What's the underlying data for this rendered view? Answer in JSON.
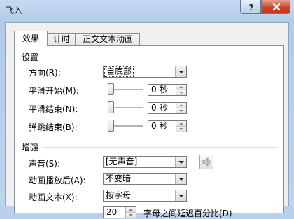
{
  "window": {
    "title": "飞入",
    "help_icon": "question-icon",
    "close_icon": "close-icon"
  },
  "tabs": [
    {
      "label": "效果",
      "active": true
    },
    {
      "label": "计时",
      "active": false
    },
    {
      "label": "正文文本动画",
      "active": false
    }
  ],
  "settings": {
    "group_label": "设置",
    "direction": {
      "label": "方向(R):",
      "value": "自底部"
    },
    "smooth_start": {
      "label": "平滑开始(M):",
      "value": "0",
      "unit": "秒"
    },
    "smooth_end": {
      "label": "平滑结束(N):",
      "value": "0",
      "unit": "秒"
    },
    "bounce_end": {
      "label": "弹跳结束(B):",
      "value": "0",
      "unit": "秒"
    }
  },
  "enhancements": {
    "group_label": "增强",
    "sound": {
      "label": "声音(S):",
      "value": "[无声音]",
      "button_icon": "speaker-icon"
    },
    "after_animation": {
      "label": "动画播放后(A):",
      "value": "不变暗"
    },
    "animate_text": {
      "label": "动画文本(X):",
      "value": "按字母"
    },
    "delay": {
      "value": "20",
      "label": "字母之间延迟百分比(D)"
    }
  }
}
